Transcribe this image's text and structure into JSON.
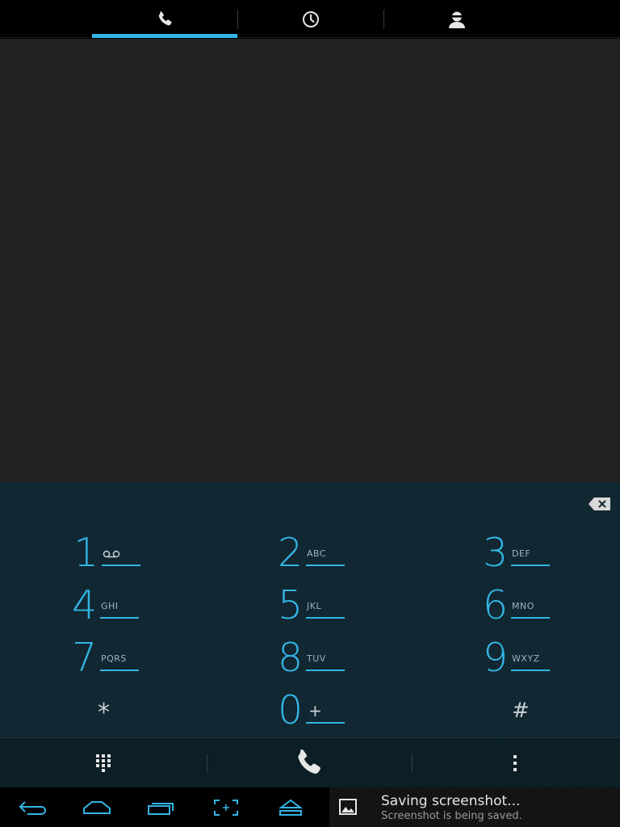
{
  "tabs": [
    {
      "id": "phone",
      "icon": "phone-icon",
      "active": true
    },
    {
      "id": "call_log",
      "icon": "clock-icon",
      "active": false
    },
    {
      "id": "contacts",
      "icon": "person-icon",
      "active": false
    }
  ],
  "colors": {
    "accent": "#33b5e5",
    "display_bg": "#222222",
    "keypad_bg": "#0f2530"
  },
  "keypad": {
    "keys": [
      {
        "digit": "1",
        "letters": ""
      },
      {
        "digit": "2",
        "letters": "ABC"
      },
      {
        "digit": "3",
        "letters": "DEF"
      },
      {
        "digit": "4",
        "letters": "GHI"
      },
      {
        "digit": "5",
        "letters": "JKL"
      },
      {
        "digit": "6",
        "letters": "MNO"
      },
      {
        "digit": "7",
        "letters": "PQRS"
      },
      {
        "digit": "8",
        "letters": "TUV"
      },
      {
        "digit": "9",
        "letters": "WXYZ"
      },
      {
        "digit": "*",
        "letters": ""
      },
      {
        "digit": "0",
        "letters": "+"
      },
      {
        "digit": "#",
        "letters": ""
      }
    ]
  },
  "actionbar": {
    "left_icon": "dialpad-icon",
    "center_icon": "call-icon",
    "right_icon": "overflow-menu-icon"
  },
  "navbar": {
    "buttons": [
      "back-icon",
      "home-icon",
      "recent-apps-icon",
      "screenshot-icon",
      "eject-icon"
    ]
  },
  "notification": {
    "title": "Saving screenshot...",
    "text": "Screenshot is being saved.",
    "icon": "image-icon"
  }
}
